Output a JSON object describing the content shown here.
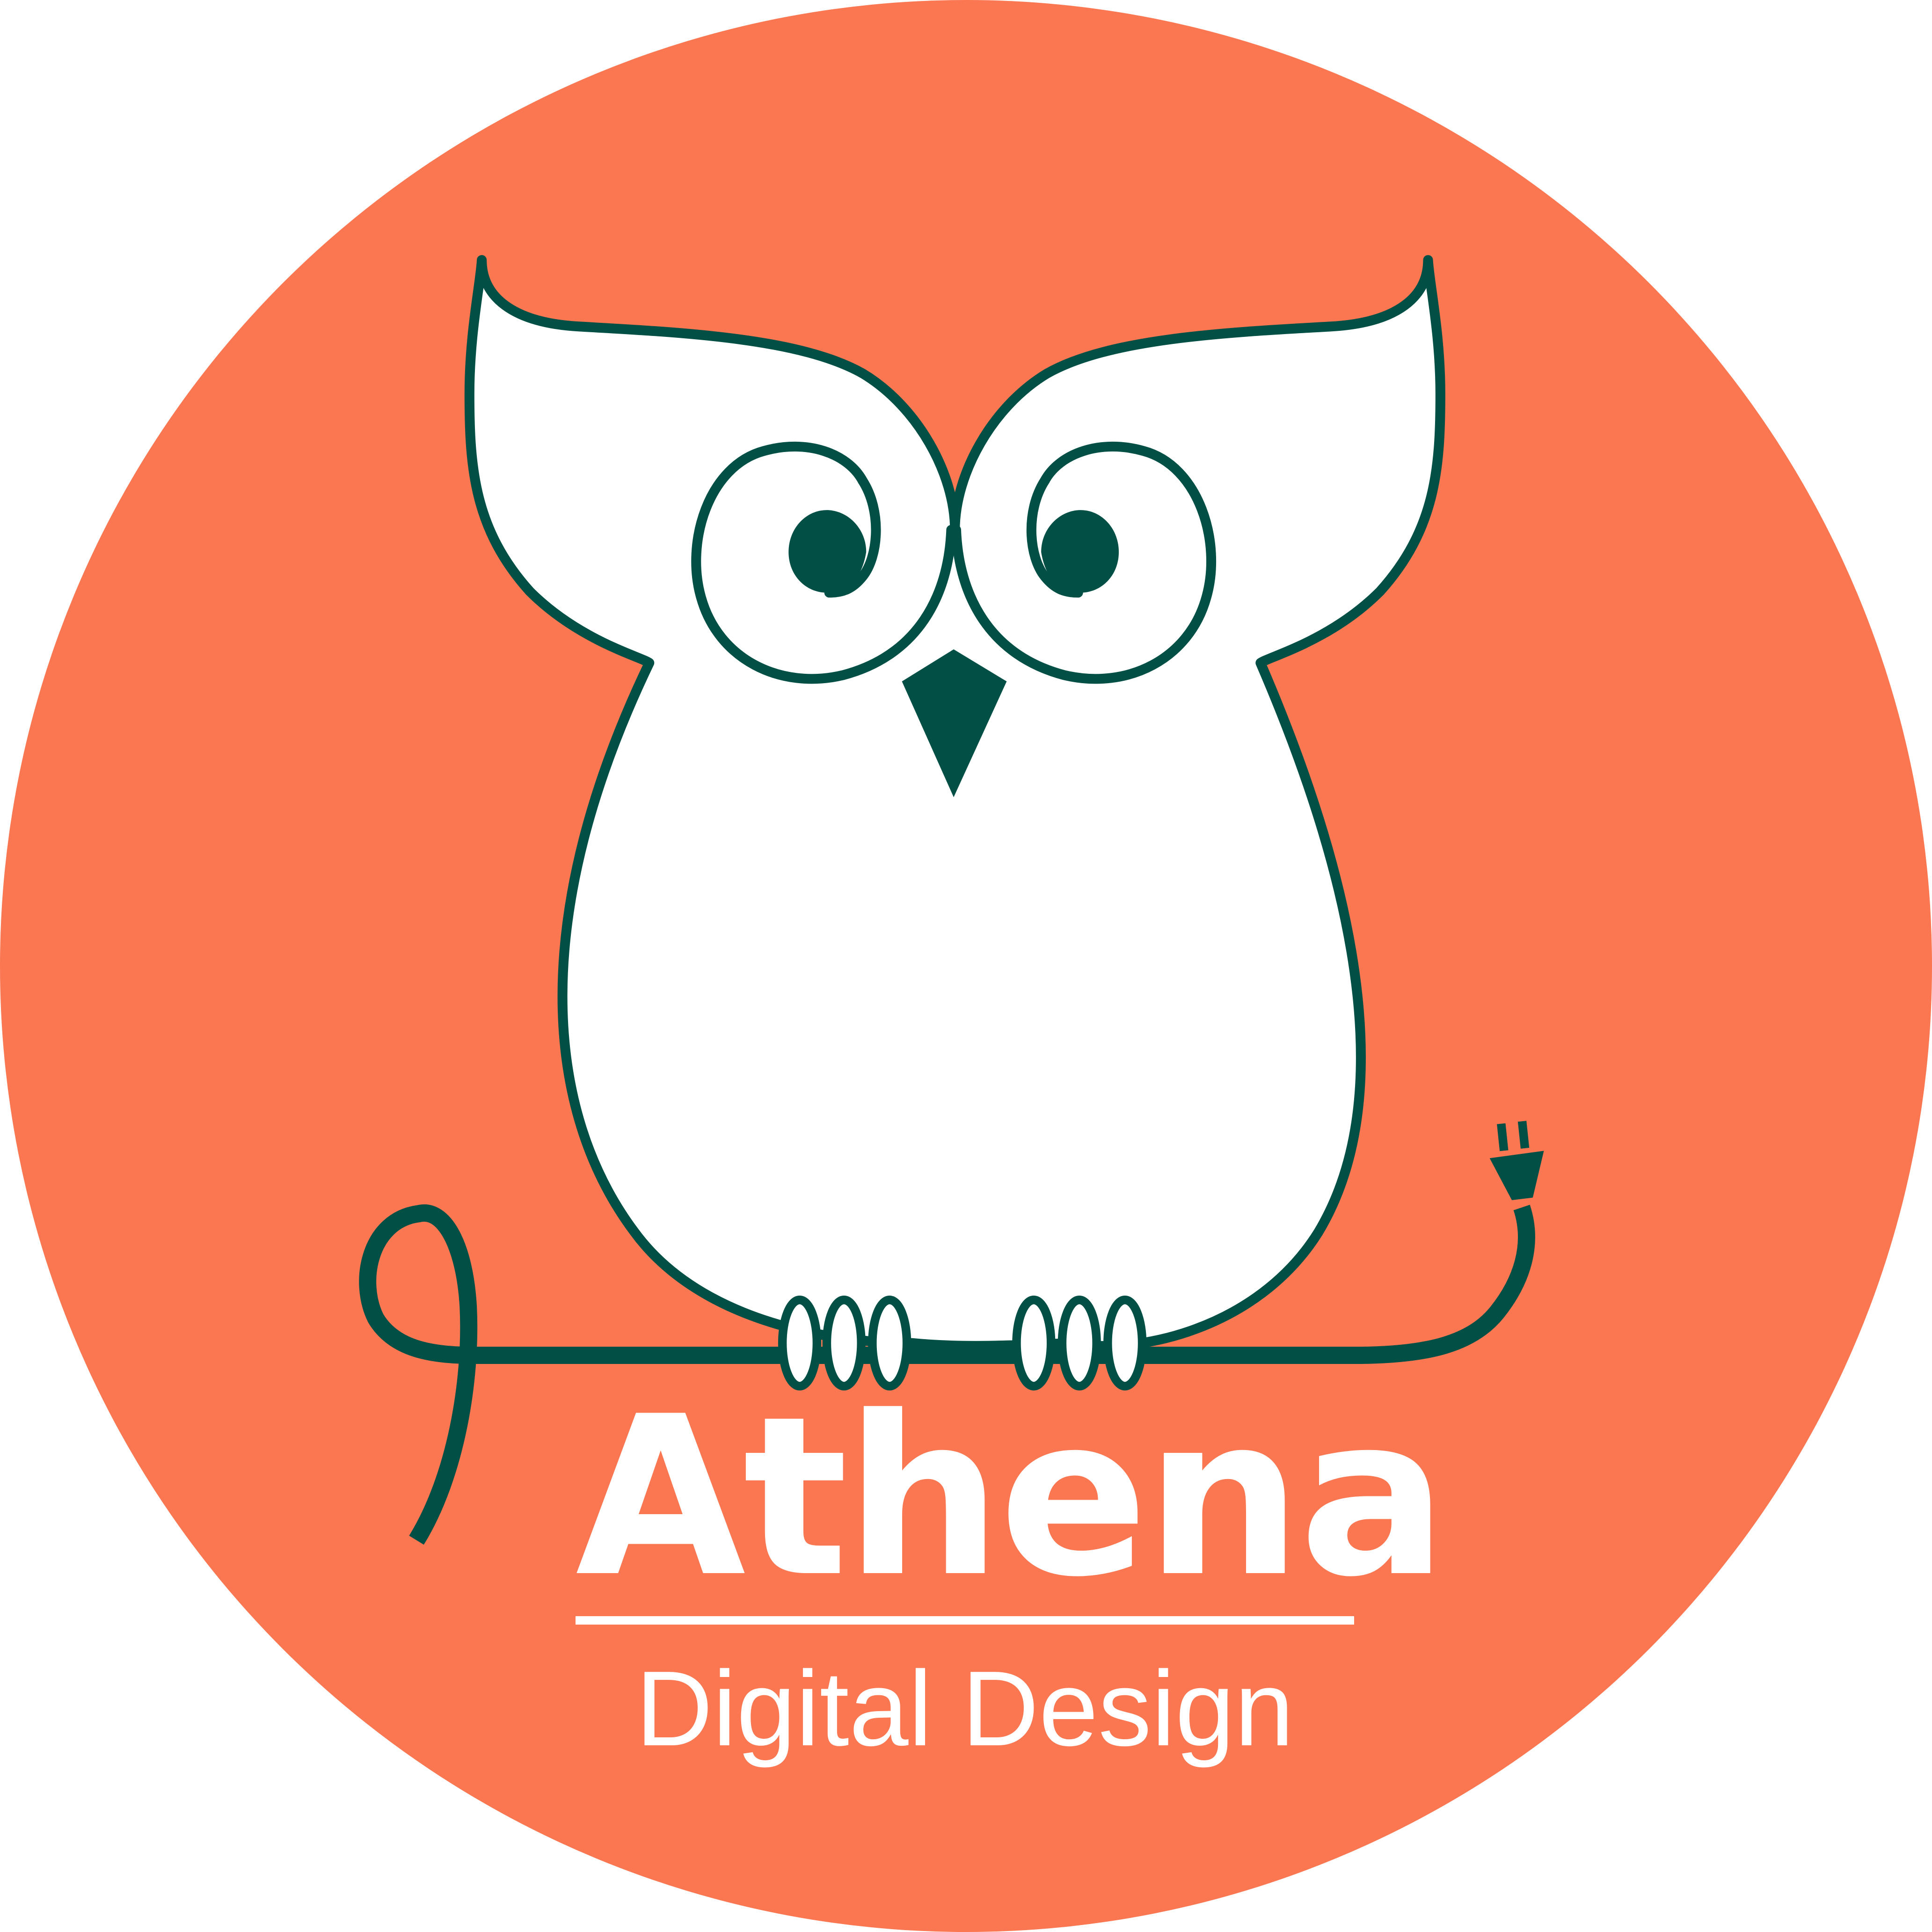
{
  "logo": {
    "brand_name": "Athena",
    "tagline": "Digital Design"
  },
  "colors": {
    "background_circle": "#FA7751",
    "outline": "#024F46",
    "owl_body": "#FFFFFF",
    "text": "#FFFFFF"
  },
  "icons": [
    "owl-icon",
    "power-cord-icon",
    "plug-icon"
  ]
}
